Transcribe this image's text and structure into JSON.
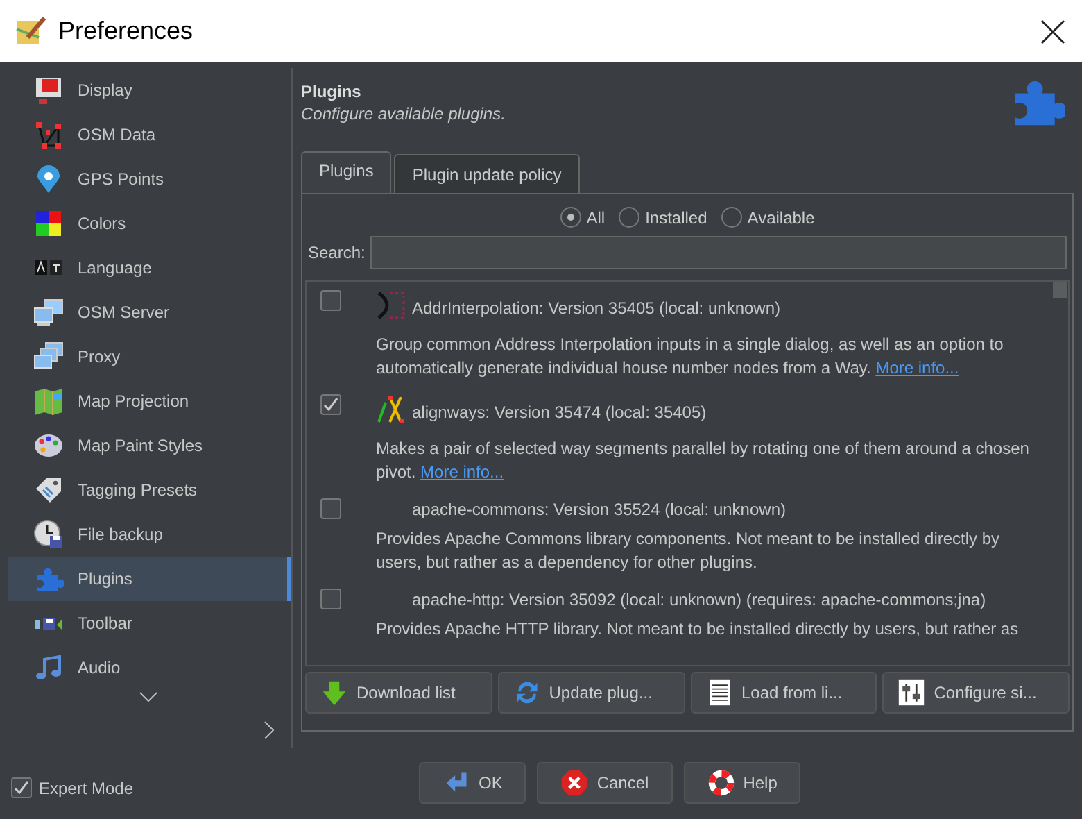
{
  "window": {
    "title": "Preferences"
  },
  "sidebar": {
    "items": [
      {
        "label": "Display",
        "selected": false
      },
      {
        "label": "OSM Data",
        "selected": false
      },
      {
        "label": "GPS Points",
        "selected": false
      },
      {
        "label": "Colors",
        "selected": false
      },
      {
        "label": "Language",
        "selected": false
      },
      {
        "label": "OSM Server",
        "selected": false
      },
      {
        "label": "Proxy",
        "selected": false
      },
      {
        "label": "Map Projection",
        "selected": false
      },
      {
        "label": "Map Paint Styles",
        "selected": false
      },
      {
        "label": "Tagging Presets",
        "selected": false
      },
      {
        "label": "File backup",
        "selected": false
      },
      {
        "label": "Plugins",
        "selected": true
      },
      {
        "label": "Toolbar",
        "selected": false
      },
      {
        "label": "Audio",
        "selected": false
      }
    ],
    "expert_mode": {
      "label": "Expert Mode",
      "checked": true
    }
  },
  "header": {
    "title": "Plugins",
    "subtitle": "Configure available plugins."
  },
  "tabs": [
    {
      "label": "Plugins",
      "selected": true
    },
    {
      "label": "Plugin update policy",
      "selected": false
    }
  ],
  "filter": [
    {
      "label": "All",
      "selected": true
    },
    {
      "label": "Installed",
      "selected": false
    },
    {
      "label": "Available",
      "selected": false
    }
  ],
  "search": {
    "label": "Search:"
  },
  "plugins": [
    {
      "checked": false,
      "title": "AddrInterpolation: Version 35405 (local: unknown)",
      "description": "Group common Address Interpolation inputs in a single dialog, as well as an option to automatically generate individual house number nodes from a Way.",
      "link": "More info..."
    },
    {
      "checked": true,
      "title": "alignways: Version 35474 (local: 35405)",
      "description": "Makes a pair of selected way segments parallel by rotating one of them around a chosen pivot.",
      "link": "More info..."
    },
    {
      "checked": false,
      "title": "apache-commons: Version 35524 (local: unknown)",
      "description": "Provides Apache Commons library components. Not meant to be installed directly by users, but rather as a dependency for other plugins."
    },
    {
      "checked": false,
      "title": "apache-http: Version 35092 (local: unknown) (requires: apache-commons;jna)",
      "description": "Provides Apache HTTP library. Not meant to be installed directly by users, but rather as"
    }
  ],
  "actions": [
    "Download list",
    "Update plug...",
    "Load from li...",
    "Configure si..."
  ],
  "buttons": [
    "OK",
    "Cancel",
    "Help"
  ]
}
